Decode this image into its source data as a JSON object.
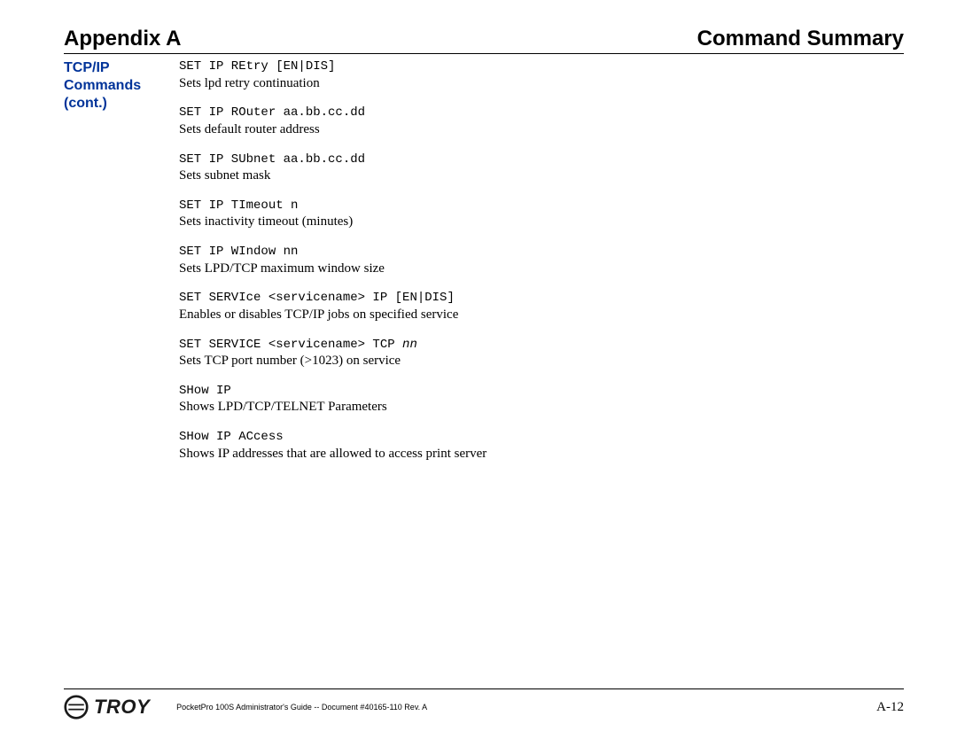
{
  "header": {
    "left": "Appendix A",
    "right": "Command Summary"
  },
  "sidebar": {
    "title_line1": "TCP/IP",
    "title_line2": "Commands",
    "title_line3": "(cont.)"
  },
  "commands": [
    {
      "cmd": "SET IP REtry [EN|DIS]",
      "desc": "Sets lpd retry continuation"
    },
    {
      "cmd": "SET IP ROuter aa.bb.cc.dd",
      "desc": "Sets default router address"
    },
    {
      "cmd": "SET IP SUbnet aa.bb.cc.dd",
      "desc": "Sets subnet mask"
    },
    {
      "cmd": "SET IP TImeout n",
      "desc": "Sets inactivity timeout (minutes)"
    },
    {
      "cmd": "SET IP WIndow nn",
      "desc": "Sets LPD/TCP maximum window size"
    },
    {
      "cmd": "SET SERVIce <servicename> IP [EN|DIS]",
      "desc": "Enables or disables TCP/IP jobs on specified service"
    },
    {
      "cmd": "SET SERVICE <servicename> TCP ",
      "cmd_italic": "nn",
      "desc": "Sets TCP port number (>1023) on service"
    },
    {
      "cmd": "SHow IP",
      "desc": "Shows LPD/TCP/TELNET Parameters"
    },
    {
      "cmd": "SHow IP ACcess",
      "desc": "Shows IP addresses that are allowed to access print server"
    }
  ],
  "footer": {
    "logo_text": "TROY",
    "doc_info": "PocketPro 100S Administrator's Guide -- Document #40165-110  Rev. A",
    "page_num": "A-12"
  }
}
